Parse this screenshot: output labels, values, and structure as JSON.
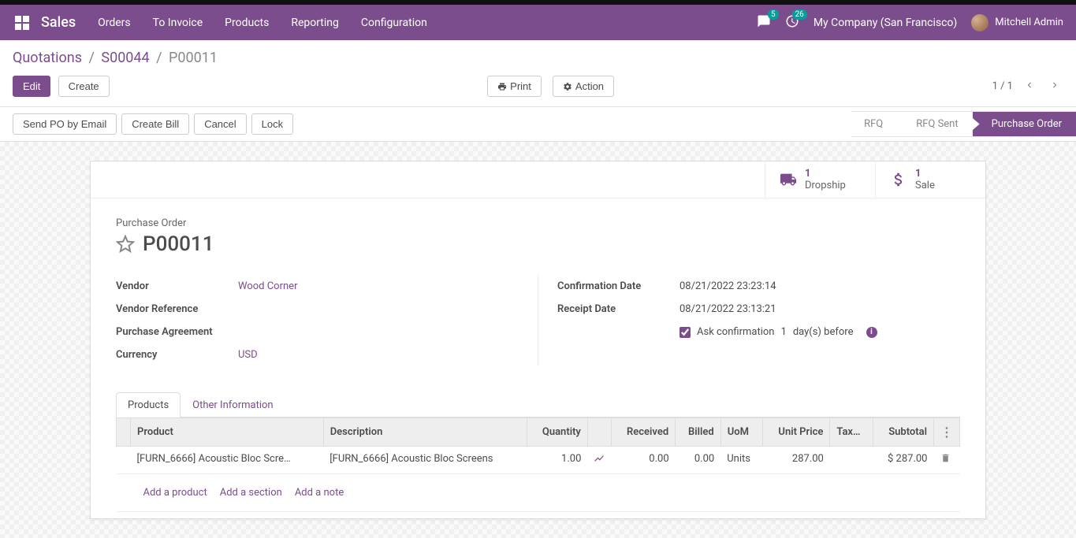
{
  "topbar": {
    "brand": "Sales",
    "menu": [
      "Orders",
      "To Invoice",
      "Products",
      "Reporting",
      "Configuration"
    ],
    "chat_count": "5",
    "activity_count": "26",
    "company": "My Company (San Francisco)",
    "user": "Mitchell Admin"
  },
  "breadcrumb": {
    "root": "Quotations",
    "parent": "S00044",
    "current": "P00011"
  },
  "buttons": {
    "edit": "Edit",
    "create": "Create",
    "print": "Print",
    "action": "Action"
  },
  "pager": {
    "range": "1 / 1"
  },
  "status_buttons": {
    "send_po": "Send PO by Email",
    "create_bill": "Create Bill",
    "cancel": "Cancel",
    "lock": "Lock"
  },
  "status_steps": {
    "rfq": "RFQ",
    "rfq_sent": "RFQ Sent",
    "po": "Purchase Order"
  },
  "stats": {
    "dropship_count": "1",
    "dropship_label": "Dropship",
    "sale_count": "1",
    "sale_label": "Sale"
  },
  "header": {
    "subtitle": "Purchase Order",
    "name": "P00011"
  },
  "fields": {
    "vendor_label": "Vendor",
    "vendor_value": "Wood Corner",
    "vendor_ref_label": "Vendor Reference",
    "vendor_ref_value": "",
    "agreement_label": "Purchase Agreement",
    "agreement_value": "",
    "currency_label": "Currency",
    "currency_value": "USD",
    "confirm_date_label": "Confirmation Date",
    "confirm_date_value": "08/21/2022 23:23:14",
    "receipt_date_label": "Receipt Date",
    "receipt_date_value": "08/21/2022 23:13:21",
    "ask_confirm_pre": "Ask confirmation",
    "ask_confirm_days": "1",
    "ask_confirm_post": "day(s) before"
  },
  "tabs": {
    "products": "Products",
    "other": "Other Information"
  },
  "table": {
    "headers": {
      "product": "Product",
      "description": "Description",
      "quantity": "Quantity",
      "received": "Received",
      "billed": "Billed",
      "uom": "UoM",
      "unit_price": "Unit Price",
      "taxes": "Tax…",
      "subtotal": "Subtotal"
    },
    "row": {
      "product": "[FURN_6666] Acoustic Bloc Scre…",
      "description": "[FURN_6666] Acoustic Bloc Screens",
      "quantity": "1.00",
      "received": "0.00",
      "billed": "0.00",
      "uom": "Units",
      "unit_price": "287.00",
      "taxes": "",
      "subtotal": "$ 287.00"
    },
    "add_product": "Add a product",
    "add_section": "Add a section",
    "add_note": "Add a note"
  }
}
